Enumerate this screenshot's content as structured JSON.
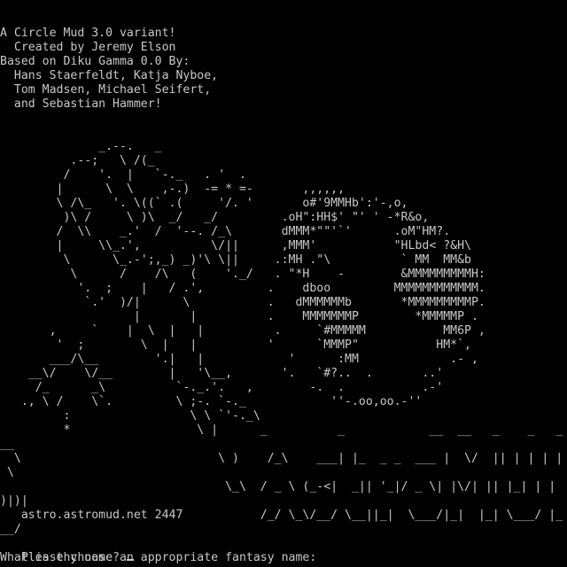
{
  "terminal": {
    "lines": [
      "A Circle Mud 3.0 variant!",
      "  Created by Jeremy Elson",
      "Based on Diku Gamma 0.0 By:",
      "  Hans Staerfeldt, Katja Nyboe,",
      "  Tom Madsen, Michael Seifert,",
      "  and Sebastian Hammer!",
      "",
      "",
      "              _.--.   _",
      "          .--;   \\ /(_",
      "         /    '.  |   `-._   . '  .",
      "        |      \\  \\    ,-.)  -= * =-       ,,,,,,",
      "        \\ /\\_   '. \\((` .(     '/. '       o#'9MMHb':'-,o,",
      "         )\\ /     \\ )\\  _/   _/         .oH\":HH$' \"' ' -*R&o,",
      "        /  \\\\    _.'  /  '--. /_\\       dMMM*\"\"'`'      .oM\"HM?.",
      "        |     \\\\_.',          \\/||      ,MMM'           \"HLbd< ?&H\\",
      "         \\      \\_.-';,_) _)'\\ \\||     .:MH .\"\\          ` MM  MM&b",
      "          \\      /    /\\   (    '._/   . \"*H    -        &MMMMMMMMMH:",
      "           '.  ;    |   / .',         .    dboo         MMMMMMMMMMMM.",
      "            `.'  )/|      \\           .   dMMMMMMb       *MMMMMMMMMP.",
      "                   |       |          .    MMMMMMMP        *MMMMMP .",
      "       ,     `    |  \\  |   |          .     `#MMMMM           MM6P ,",
      "        '  ;        \\  |   |          '      `MMMP\"           HM*`,",
      "       ___/\\__        '.|   |            '      :MM             .- ,",
      "    __\\/    \\/__        |   '\\__,       '.   `#?..  .       ..'",
      "     /_      _\\          `-._.'.   ,        -.  .           .-'",
      "   ., \\ /    \\`.         \\ ;-. `-._            ''-.oo,oo.-''",
      "         :                 \\ \\ `'-._\\",
      "         *                  \\ |      _          _            __  __   _    _   _",
      "__",
      "  \\                            \\ )    /_\\    ___| |_  _ _  ___ |  \\/  || | | | |",
      " \\",
      "                                \\_\\  / _ \\ (_-<|  _|| '_|/ _ \\| |\\/| || |_| | |",
      ")|)|",
      "   astro.astromud.net 2447           /_/ \\_\\/__/ \\__||_|  \\___/|_|  |_| \\___/ |_",
      "__/",
      "",
      "   Please choose an appropriate fantasy name:",
      ""
    ],
    "prompt_text": "What is thy name?"
  },
  "colors": {
    "background": "#000000",
    "foreground": "#c8c8c8"
  }
}
